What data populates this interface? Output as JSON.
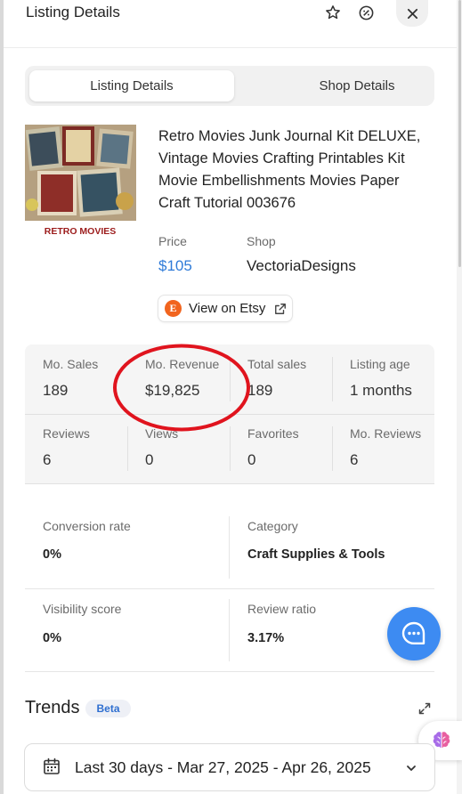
{
  "header": {
    "title": "Listing Details",
    "icons": [
      "star-icon",
      "badge-icon",
      "close-icon"
    ]
  },
  "tabs": {
    "active": "Listing Details",
    "inactive": "Shop Details"
  },
  "product": {
    "image_caption": "RETRO MOVIES",
    "title": "Retro Movies Junk Journal Kit DELUXE, Vintage Movies Crafting Printables Kit Movie Embellishments Movies Paper Craft Tutorial 003676",
    "price_label": "Price",
    "price": "$105",
    "shop_label": "Shop",
    "shop": "VectoriaDesigns",
    "etsy_logo_letter": "E",
    "etsy_button": "View on Etsy"
  },
  "stats": [
    {
      "label": "Mo. Sales",
      "value": "189"
    },
    {
      "label": "Mo. Revenue",
      "value": "$19,825"
    },
    {
      "label": "Total sales",
      "value": "189"
    },
    {
      "label": "Listing age",
      "value": "1 months"
    },
    {
      "label": "Reviews",
      "value": "6"
    },
    {
      "label": "Views",
      "value": "0"
    },
    {
      "label": "Favorites",
      "value": "0"
    },
    {
      "label": "Mo. Reviews",
      "value": "6"
    }
  ],
  "metrics": {
    "conversion_label": "Conversion rate",
    "conversion_value": "0%",
    "category_label": "Category",
    "category_value": "Craft Supplies & Tools",
    "visibility_label": "Visibility score",
    "visibility_value": "0%",
    "review_ratio_label": "Review ratio",
    "review_ratio_value": "3.17%"
  },
  "trends": {
    "title": "Trends",
    "badge": "Beta"
  },
  "date_range": {
    "value": "Last 30 days - Mar 27, 2025 - Apr 26, 2025"
  },
  "colors": {
    "accent_blue": "#2f7bd8",
    "chat_blue": "#3d8bf2",
    "etsy_orange": "#f1641e",
    "annotation_red": "#e0141e"
  }
}
